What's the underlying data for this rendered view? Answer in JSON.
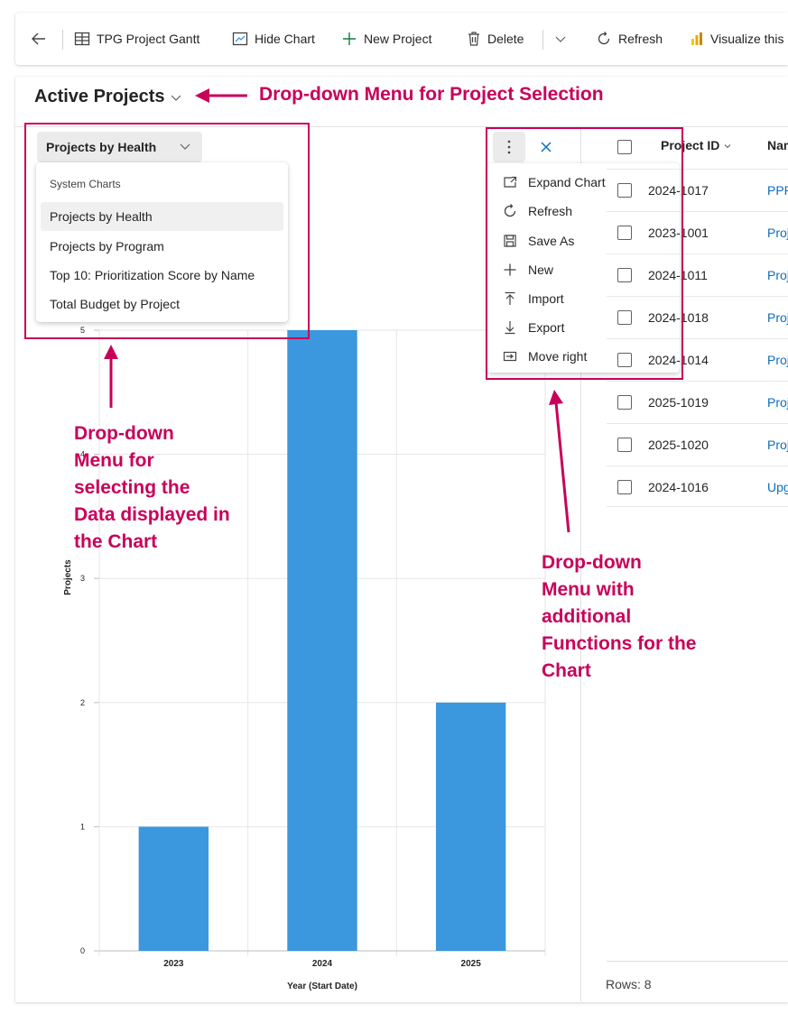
{
  "toolbar": {
    "back_icon": "arrow-left-icon",
    "gantt_label": "TPG Project Gantt",
    "hide_chart_label": "Hide Chart",
    "new_project_label": "New Project",
    "delete_label": "Delete",
    "refresh_label": "Refresh",
    "visualize_label": "Visualize this"
  },
  "view": {
    "title": "Active Projects"
  },
  "chart_selector": {
    "selected": "Projects by Health",
    "group_header": "System Charts",
    "options": [
      "Projects by Health",
      "Projects by Program",
      "Top 10: Prioritization Score by Name",
      "Total Budget by Project"
    ]
  },
  "chart_menu": {
    "items": [
      {
        "label": "Expand Chart",
        "icon": "expand-chart-icon"
      },
      {
        "label": "Refresh",
        "icon": "refresh-icon"
      },
      {
        "label": "Save As",
        "icon": "save-icon"
      },
      {
        "label": "New",
        "icon": "plus-icon"
      },
      {
        "label": "Import",
        "icon": "import-icon"
      },
      {
        "label": "Export",
        "icon": "export-icon"
      },
      {
        "label": "Move right",
        "icon": "move-right-icon"
      }
    ]
  },
  "grid": {
    "columns": {
      "project_id": "Project ID",
      "name": "Name"
    },
    "rows": [
      {
        "project_id": "2024-1017",
        "name": "PPP"
      },
      {
        "project_id": "2023-1001",
        "name": "Proj"
      },
      {
        "project_id": "2024-1011",
        "name": "Proj"
      },
      {
        "project_id": "2024-1018",
        "name": "Proj"
      },
      {
        "project_id": "2024-1014",
        "name": "Proj"
      },
      {
        "project_id": "2025-1019",
        "name": "Proj"
      },
      {
        "project_id": "2025-1020",
        "name": "Proj"
      },
      {
        "project_id": "2024-1016",
        "name": "Upg"
      }
    ],
    "rows_label": "Rows: 8"
  },
  "chart_data": {
    "type": "bar",
    "categories": [
      "2023",
      "2024",
      "2025"
    ],
    "values": [
      1,
      5,
      2
    ],
    "xlabel": "Year (Start Date)",
    "ylabel": "Projects",
    "ylim": [
      0,
      5
    ],
    "yticks": [
      0,
      1,
      2,
      3,
      4,
      5
    ],
    "bar_color": "#3b97de"
  },
  "annotations": {
    "project_selection": "Drop-down Menu for Project Selection",
    "chart_data_lines": [
      "Drop-down",
      "Menu for",
      "selecting the",
      "Data displayed in",
      "the Chart"
    ],
    "chart_functions_lines": [
      "Drop-down",
      "Menu with",
      "additional",
      "Functions for the",
      "Chart"
    ],
    "color": "#c8005a"
  }
}
